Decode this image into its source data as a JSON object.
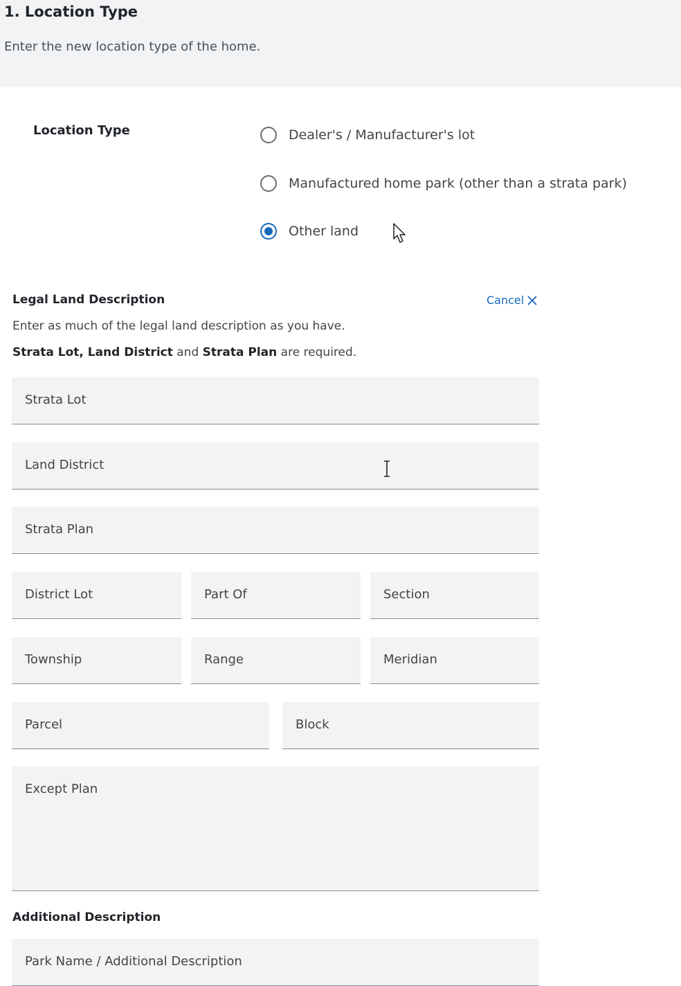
{
  "section": {
    "title": "1. Location Type",
    "subtitle": "Enter the new location type of the home."
  },
  "location_type": {
    "label": "Location Type",
    "options": [
      {
        "label": "Dealer's / Manufacturer's lot",
        "selected": false
      },
      {
        "label": "Manufactured home park (other than a strata park)",
        "selected": false
      },
      {
        "label": "Other land",
        "selected": true
      }
    ]
  },
  "legal": {
    "title": "Legal Land Description",
    "cancel_label": "Cancel",
    "instruction": "Enter as much of the legal land description as you have.",
    "required_parts": {
      "bold1": "Strata Lot, Land District",
      "and": " and ",
      "bold2": "Strata Plan",
      "suffix": " are required."
    },
    "fields": {
      "strata_lot": "Strata Lot",
      "land_district": "Land District",
      "strata_plan": "Strata Plan",
      "district_lot": "District Lot",
      "part_of": "Part Of",
      "section": "Section",
      "township": "Township",
      "range": "Range",
      "meridian": "Meridian",
      "parcel": "Parcel",
      "block": "Block",
      "except_plan": "Except Plan"
    }
  },
  "additional": {
    "title": "Additional Description",
    "placeholder": "Park Name / Additional Description"
  },
  "colors": {
    "accent": "#1669bb",
    "field_bg": "#f1f3f5",
    "header_bg": "#f1f3f5"
  }
}
